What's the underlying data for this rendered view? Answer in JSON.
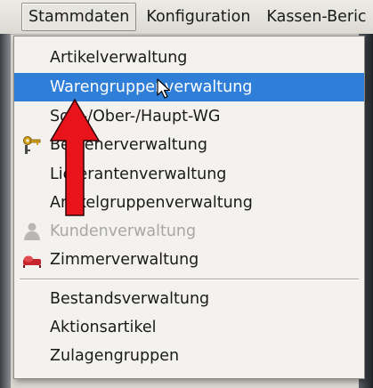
{
  "menubar": {
    "items": [
      {
        "label": "Stammdaten"
      },
      {
        "label": "Konfiguration"
      },
      {
        "label": "Kassen-Beric"
      }
    ]
  },
  "dropdown": {
    "items": [
      {
        "label": "Artikelverwaltung"
      },
      {
        "label": "Warengruppenverwaltung",
        "state": "highlighted"
      },
      {
        "label": "Sort-/Ober-/Haupt-WG"
      },
      {
        "label": "Bedienerverwaltung",
        "icon": "keys-icon"
      },
      {
        "label": "Lieferantenverwaltung"
      },
      {
        "label": "Artikelgruppenverwaltung"
      },
      {
        "label": "Kundenverwaltung",
        "state": "disabled",
        "icon": "customer-icon"
      },
      {
        "label": "Zimmerverwaltung",
        "icon": "bed-icon"
      },
      {
        "label": "Bestandsverwaltung"
      },
      {
        "label": "Aktionsartikel"
      },
      {
        "label": "Zulagengruppen"
      }
    ]
  },
  "annotation": {
    "arrow_color": "#e8141b",
    "highlight_color": "#2f7fd8"
  }
}
